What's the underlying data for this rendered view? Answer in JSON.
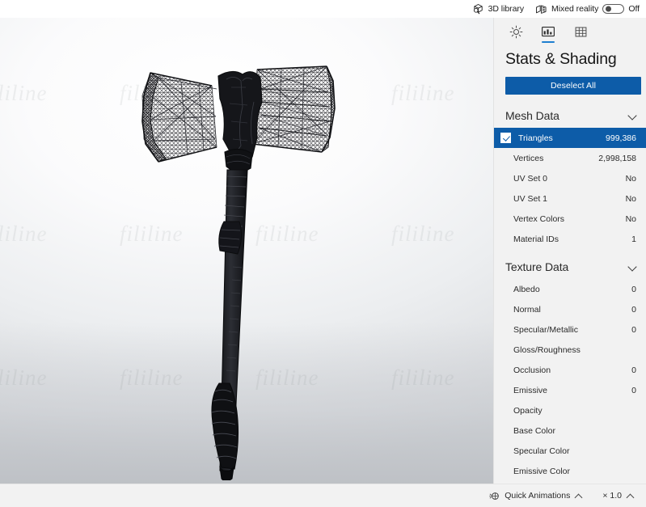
{
  "topbar": {
    "library_label": "3D library",
    "library_icon": "cube-search-icon",
    "mixed_reality_label": "Mixed reality",
    "mixed_reality_icon": "mixed-reality-icon",
    "mixed_reality_state": "Off",
    "toggle_on": false
  },
  "sidebar": {
    "tabs": [
      {
        "name": "lighting",
        "icon": "sun-icon",
        "active": false
      },
      {
        "name": "stats-shading",
        "icon": "image-stats-icon",
        "active": true
      },
      {
        "name": "grid",
        "icon": "grid-icon",
        "active": false
      }
    ],
    "title": "Stats & Shading",
    "deselect_label": "Deselect All",
    "groups": [
      {
        "name": "mesh-data",
        "label": "Mesh Data",
        "expanded": true,
        "rows": [
          {
            "name": "triangles",
            "label": "Triangles",
            "value": "999,386",
            "selected": true,
            "checkbox": true
          },
          {
            "name": "vertices",
            "label": "Vertices",
            "value": "2,998,158",
            "selected": false,
            "checkbox": false
          },
          {
            "name": "uv-set-0",
            "label": "UV Set 0",
            "value": "No",
            "selected": false,
            "checkbox": false
          },
          {
            "name": "uv-set-1",
            "label": "UV Set 1",
            "value": "No",
            "selected": false,
            "checkbox": false
          },
          {
            "name": "vertex-colors",
            "label": "Vertex Colors",
            "value": "No",
            "selected": false,
            "checkbox": false
          },
          {
            "name": "material-ids",
            "label": "Material IDs",
            "value": "1",
            "selected": false,
            "checkbox": false
          }
        ]
      },
      {
        "name": "texture-data",
        "label": "Texture Data",
        "expanded": true,
        "rows": [
          {
            "name": "albedo",
            "label": "Albedo",
            "value": "0",
            "selected": false,
            "checkbox": false
          },
          {
            "name": "normal",
            "label": "Normal",
            "value": "0",
            "selected": false,
            "checkbox": false
          },
          {
            "name": "specular-metallic",
            "label": "Specular/Metallic",
            "value": "0",
            "selected": false,
            "checkbox": false
          },
          {
            "name": "gloss-roughness",
            "label": "Gloss/Roughness",
            "value": "",
            "selected": false,
            "checkbox": false
          },
          {
            "name": "occlusion",
            "label": "Occlusion",
            "value": "0",
            "selected": false,
            "checkbox": false
          },
          {
            "name": "emissive",
            "label": "Emissive",
            "value": "0",
            "selected": false,
            "checkbox": false
          },
          {
            "name": "opacity",
            "label": "Opacity",
            "value": "",
            "selected": false,
            "checkbox": false
          },
          {
            "name": "base-color",
            "label": "Base Color",
            "value": "",
            "selected": false,
            "checkbox": false
          },
          {
            "name": "specular-color",
            "label": "Specular Color",
            "value": "",
            "selected": false,
            "checkbox": false
          },
          {
            "name": "emissive-color",
            "label": "Emissive Color",
            "value": "",
            "selected": false,
            "checkbox": false
          }
        ]
      }
    ]
  },
  "bottombar": {
    "quick_animations_label": "Quick Animations",
    "quick_animations_icon": "animation-icon",
    "speed_label": "× 1.0"
  },
  "viewport": {
    "model_name": "double-bladed-axe-wireframe",
    "watermark_text": "fililine",
    "background_top": "#fbfbfc",
    "background_bottom": "#c6c9ce"
  },
  "colors": {
    "accent": "#0d5ca8",
    "tab_underline": "#1f7fd0",
    "panel_bg": "#f2f2f2"
  }
}
